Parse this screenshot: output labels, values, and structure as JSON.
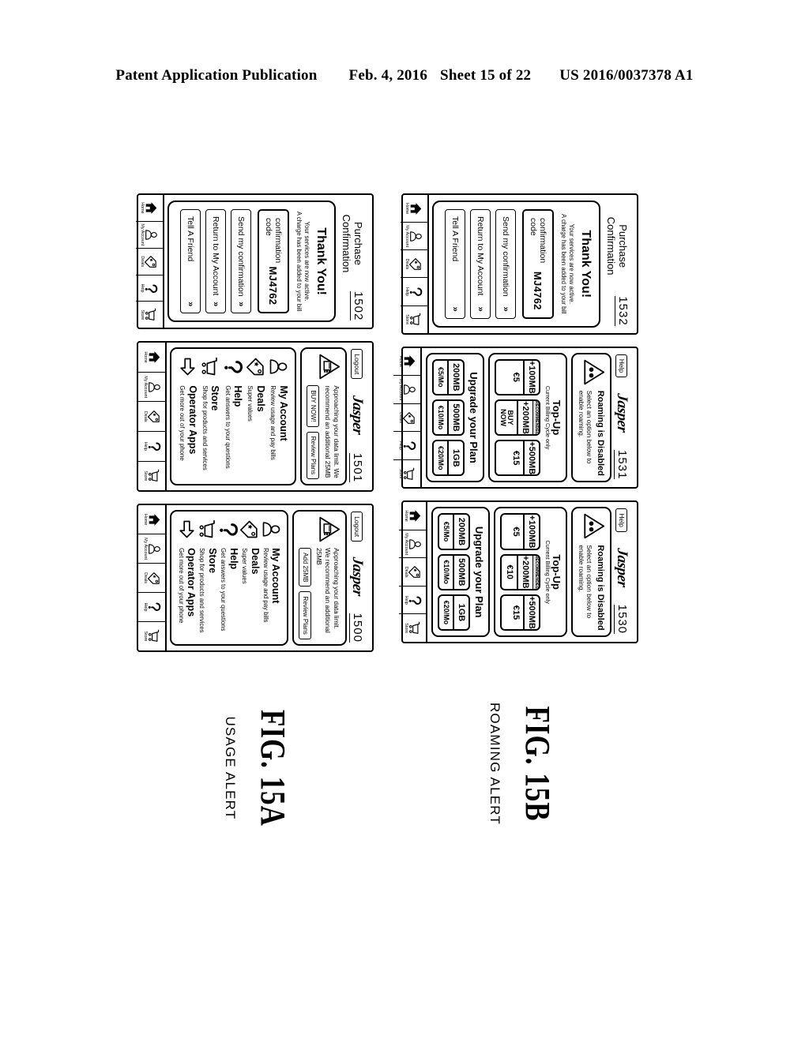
{
  "page_header": {
    "publication": "Patent Application Publication",
    "date": "Feb. 4, 2016",
    "sheet": "Sheet 15 of 22",
    "number": "US 2016/0037378 A1"
  },
  "figures": [
    {
      "id": "fig-15a",
      "number": "FIG. 15A",
      "subtitle": "USAGE ALERT",
      "screens": [
        {
          "ref": "1500",
          "type": "menu",
          "topbar": {
            "left_button": "Logout",
            "brand": "Jasper"
          },
          "alert": {
            "icon": "data-usage-warning-icon",
            "text": "Approaching your data limit. We recommend an additional 25MB",
            "buttons": [
              "Add 25MB",
              "Review Plans"
            ]
          },
          "menu": [
            {
              "icon": "person-icon",
              "title": "My Account",
              "sub": "Review usage and pay bills"
            },
            {
              "icon": "tag-icon",
              "title": "Deals",
              "sub": "Super values"
            },
            {
              "icon": "question-icon",
              "title": "Help",
              "sub": "Get answers to your questions"
            },
            {
              "icon": "cart-icon",
              "title": "Store",
              "sub": "Shop for products and services"
            },
            {
              "icon": "arrow-icon",
              "title": "Operator Apps",
              "sub": "Get more out of your phone"
            }
          ]
        },
        {
          "ref": "1501",
          "type": "menu",
          "topbar": {
            "left_button": "Logout",
            "brand": "Jasper"
          },
          "alert": {
            "icon": "data-usage-warning-icon",
            "text": "Approaching your data limit. We recommend an additional 25MB",
            "buttons": [
              "BUY NOW!",
              "Review Plans"
            ]
          },
          "menu": [
            {
              "icon": "person-icon",
              "title": "My Account",
              "sub": "Review usage and pay bills"
            },
            {
              "icon": "tag-icon",
              "title": "Deals",
              "sub": "Super values"
            },
            {
              "icon": "question-icon",
              "title": "Help",
              "sub": "Get answers to your questions"
            },
            {
              "icon": "cart-icon",
              "title": "Store",
              "sub": "Shop for products and services"
            },
            {
              "icon": "arrow-icon",
              "title": "Operator Apps",
              "sub": "Get more out of your phone"
            }
          ]
        },
        {
          "ref": "1502",
          "type": "confirmation",
          "title": "Purchase Confirmation",
          "thanks": "Thank You!",
          "thanks_sub_line1": "Your services are now active.",
          "thanks_sub_line2": "A charge has been added to your bill",
          "code_label": "confirmation code",
          "code_value": "MJ4762",
          "actions": [
            "Send my confirmation",
            "Return to My Account",
            "Tell A Friend"
          ],
          "chevron": "»"
        }
      ]
    },
    {
      "id": "fig-15b",
      "number": "FIG. 15B",
      "subtitle": "ROAMING ALERT",
      "screens": [
        {
          "ref": "1530",
          "type": "roaming",
          "topbar": {
            "left_button": "Help",
            "brand": "Jasper"
          },
          "alert": {
            "icon": "roaming-warning-icon",
            "head": "Roaming is Disabled",
            "sub": "Select an option below to enable roaming."
          },
          "topup": {
            "title": "Top-Up",
            "sub": "Current Billing Cycle only",
            "recommended_label": "RECOMMENDED",
            "tiles": [
              {
                "size": "+100MB",
                "price": "€5",
                "recommended": false
              },
              {
                "size": "+200MB",
                "price": "€10",
                "recommended": true
              },
              {
                "size": "+500MB",
                "price": "€15",
                "recommended": false
              }
            ]
          },
          "upgrade": {
            "title": "Upgrade your Plan",
            "tiles": [
              {
                "size": "200MB",
                "price": "€5/Mo"
              },
              {
                "size": "500MB",
                "price": "€10/Mo"
              },
              {
                "size": "1GB",
                "price": "€20/Mo"
              }
            ]
          }
        },
        {
          "ref": "1531",
          "type": "roaming",
          "topbar": {
            "left_button": "Help",
            "brand": "Jasper"
          },
          "alert": {
            "icon": "roaming-warning-icon",
            "head": "Roaming is Disabled",
            "sub": "Select an option below to enable roaming."
          },
          "topup": {
            "title": "Top-Up",
            "sub": "Current Billing Cycle only",
            "recommended_label": "RECOMMENDED",
            "tiles": [
              {
                "size": "+100MB",
                "price": "€5",
                "recommended": false
              },
              {
                "size": "+200MB",
                "price": "BUY NOW",
                "recommended": true
              },
              {
                "size": "+500MB",
                "price": "€15",
                "recommended": false
              }
            ]
          },
          "upgrade": {
            "title": "Upgrade your Plan",
            "tiles": [
              {
                "size": "200MB",
                "price": "€5/Mo"
              },
              {
                "size": "500MB",
                "price": "€10/Mo"
              },
              {
                "size": "1GB",
                "price": "€20/Mo"
              }
            ]
          }
        },
        {
          "ref": "1532",
          "type": "confirmation",
          "title": "Purchase Confirmation",
          "thanks": "Thank You!",
          "thanks_sub_line1": "Your services are now active.",
          "thanks_sub_line2": "A charge has been added to your bill",
          "code_label": "confirmation code",
          "code_value": "MJ4762",
          "actions": [
            "Send my confirmation",
            "Return to My Account",
            "Tell A Friend"
          ],
          "chevron": "»"
        }
      ]
    }
  ],
  "navbar": [
    {
      "icon": "home-icon",
      "label": "Home"
    },
    {
      "icon": "person-icon",
      "label": "My Account"
    },
    {
      "icon": "tag-icon",
      "label": "Deals"
    },
    {
      "icon": "question-icon",
      "label": "Help"
    },
    {
      "icon": "cart-icon",
      "label": "Store"
    }
  ]
}
